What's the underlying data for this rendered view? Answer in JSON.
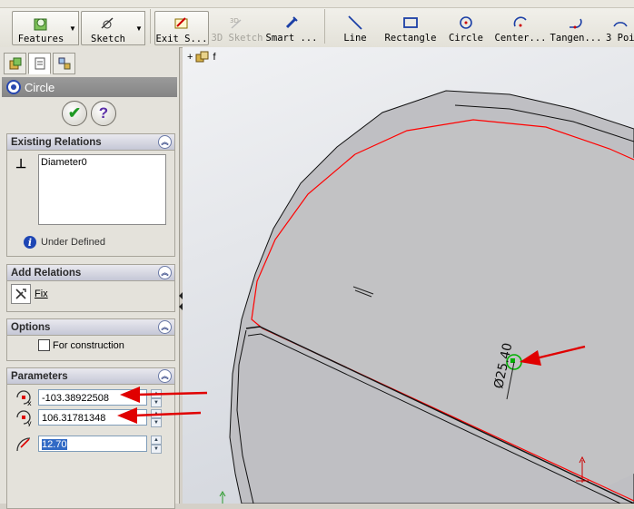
{
  "toolbar": {
    "buttons": [
      {
        "id": "features",
        "label": "Features"
      },
      {
        "id": "sketch",
        "label": "Sketch"
      },
      {
        "id": "exit_sketch",
        "label": "Exit S..."
      },
      {
        "id": "sketch3d",
        "label": "3D Sketch"
      },
      {
        "id": "smart_dim",
        "label": "Smart ..."
      },
      {
        "id": "line",
        "label": "Line"
      },
      {
        "id": "rectangle",
        "label": "Rectangle"
      },
      {
        "id": "circle",
        "label": "Circle"
      },
      {
        "id": "center_arc",
        "label": "Center..."
      },
      {
        "id": "tangent_arc",
        "label": "Tangen..."
      },
      {
        "id": "three_point",
        "label": "3 Poi"
      }
    ]
  },
  "panel": {
    "title": "Circle",
    "existing_relations": {
      "header": "Existing Relations",
      "items": [
        "Diameter0"
      ],
      "status": "Under Defined"
    },
    "add_relations": {
      "header": "Add Relations",
      "fix_label": "Fix"
    },
    "options": {
      "header": "Options",
      "construction_label": "For construction",
      "construction_checked": false
    },
    "parameters": {
      "header": "Parameters",
      "center_x": "-103.38922508",
      "center_y": "106.31781348",
      "radius": "12.70"
    }
  },
  "canvas": {
    "breadcrumb": "f",
    "dimension_label": "Ø25.40"
  },
  "colors": {
    "highlight_edge": "#ff0000",
    "selection": "#316ac5",
    "dimension_circle": "#00b000"
  }
}
